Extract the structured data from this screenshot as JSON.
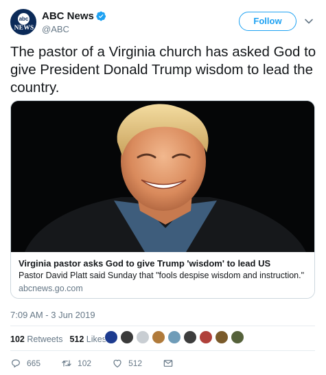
{
  "account": {
    "avatar_top": "abc",
    "avatar_bottom": "NEWS",
    "display_name": "ABC News",
    "handle": "@ABC",
    "verified_icon": "verified-badge-icon"
  },
  "follow_label": "Follow",
  "tweet_text": "The pastor of a Virginia church has asked God to give President Donald Trump wisdom to lead the country.",
  "card": {
    "title": "Virginia pastor asks God to give Trump 'wisdom' to lead US",
    "description": "Pastor David Platt said Sunday that \"fools despise wisdom and instruction.\"",
    "domain": "abcnews.go.com"
  },
  "timestamp": "7:09 AM - 3 Jun 2019",
  "stats": {
    "retweets_count": "102",
    "retweets_label": "Retweets",
    "likes_count": "512",
    "likes_label": "Likes"
  },
  "likers": [
    "#1d3b8f",
    "#3a3a3a",
    "#c9ced3",
    "#b07a3a",
    "#6f9cb8",
    "#3d3d3d",
    "#b0403a",
    "#7a5a2a",
    "#55613a"
  ],
  "actions": {
    "replies": "665",
    "retweets": "102",
    "likes": "512"
  },
  "colors": {
    "accent": "#1da1f2",
    "secondary_text": "#657786",
    "border": "#ccd6dd",
    "brand_navy": "#0b2a58"
  }
}
